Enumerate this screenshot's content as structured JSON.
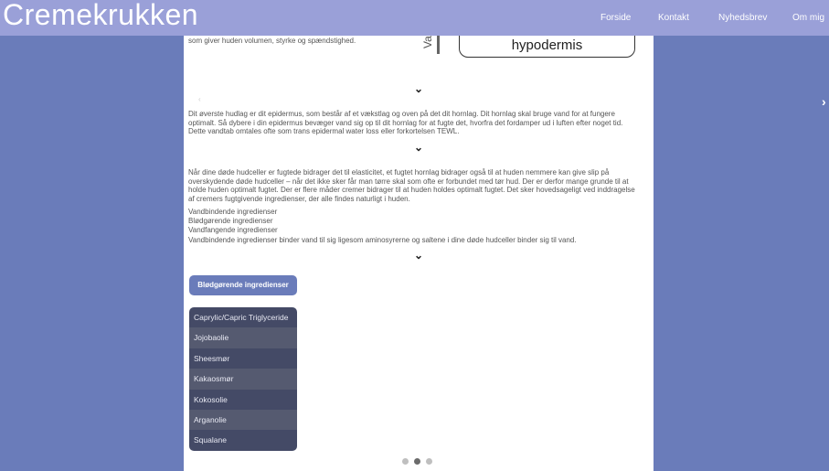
{
  "header": {
    "brand": "Cremekrukken",
    "nav": [
      "Forside",
      "Kontakt",
      "Nyhedsbrev",
      "Om mig"
    ]
  },
  "content": {
    "top_fragment": "som giver huden volumen, styrke og spændstighed.",
    "diagram_side_label": "Va",
    "diagram_box_label": "hypodermis",
    "epidermis_paragraph": "Dit øverste hudlag er dit epidermus, som består af et vækstlag og oven på det dit hornlag. Dit hornlag skal bruge vand for at fungere optimalt. Så dybere i din epidermus bevæger vand sig op til dit hornlag for at fugte det, hvorfra det fordamper ud i luften efter noget tid. Dette vandtab omtales ofte som trans epidermal water loss eller forkortelsen TEWL.",
    "moisture_paragraph": "Når dine døde hudceller er fugtede bidrager det til elasticitet, et fugtet hornlag bidrager også til at huden nemmere kan give slip på overskydende døde hudceller – når det ikke sker får man tørre skal som ofte er forbundet med tør hud. Der er derfor mange grunde til at holde huden optimalt fugtet. Der er flere måder cremer bidrager til at huden holdes optimalt fugtet. Det sker hovedsageligt ved inddragelse af cremers fugtgivende ingredienser, der alle findes naturligt i huden.",
    "list_items": [
      "Vandbindende ingredienser",
      "Blødgørende ingredienser",
      "Vandfangende ingredienser"
    ],
    "binding_paragraph": "Vandbindende ingredienser binder vand til sig ligesom aminosyrerne og saltene i dine døde hudceller binder sig til vand.",
    "chevron": "⌄",
    "small_marker": "‹"
  },
  "tab": {
    "label": "Blødgørende ingredienser"
  },
  "ingredients": [
    "Caprylic/Capric Triglyceride",
    "Jojobaolie",
    "Sheesmør",
    "Kakaosmør",
    "Kokosolie",
    "Arganolie",
    "Squalane"
  ],
  "carousel": {
    "dots": 3,
    "active_index": 1,
    "next_arrow": "›"
  },
  "colors": {
    "background": "#6a7cba",
    "header": "#9aa0d8",
    "tab_button": "#6a7cba",
    "list_odd": "#444a66",
    "list_even": "#555a70"
  }
}
